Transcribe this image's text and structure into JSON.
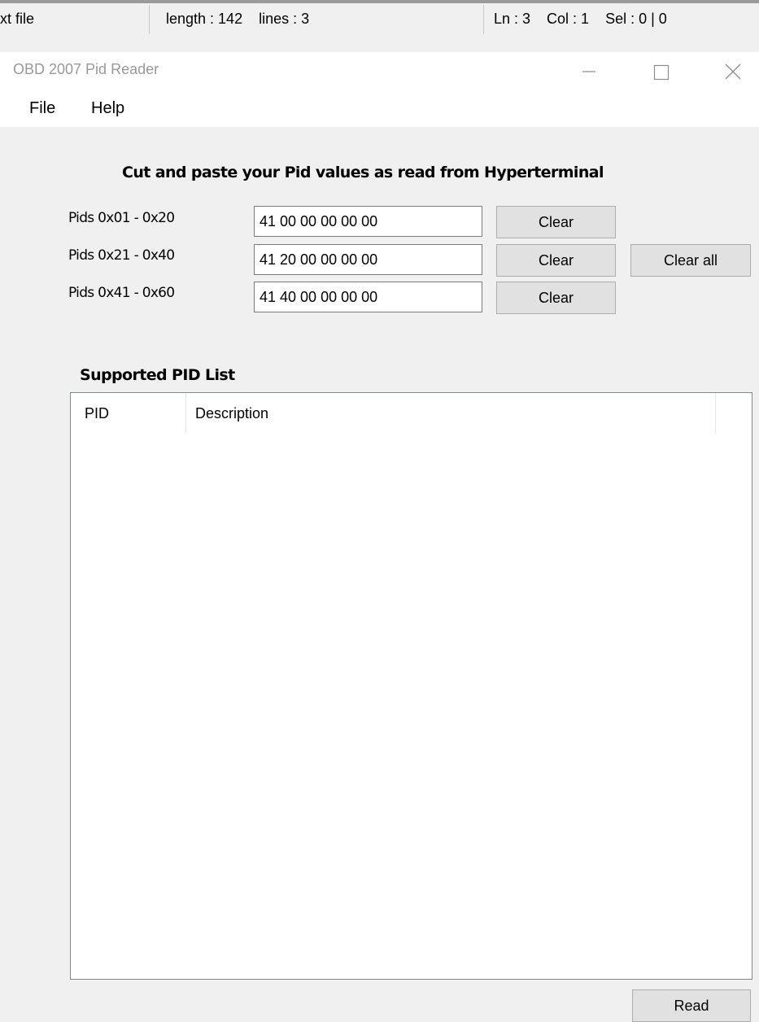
{
  "background_editor": {
    "status_bar": {
      "file_type": "xt file",
      "length_lines": "length : 142    lines : 3",
      "position": "Ln : 3    Col : 1    Sel : 0 | 0"
    }
  },
  "window": {
    "title": "OBD 2007 Pid Reader"
  },
  "menu": {
    "items": [
      "File",
      "Help"
    ]
  },
  "form": {
    "instruction": "Cut and paste your Pid values as read from Hyperterminal",
    "rows": [
      {
        "label": "Pids 0x01 - 0x20",
        "value": "41 00 00 00 00 00",
        "clear_label": "Clear"
      },
      {
        "label": "Pids 0x21 - 0x40",
        "value": "41 20 00 00 00 00",
        "clear_label": "Clear"
      },
      {
        "label": "Pids 0x41 - 0x60",
        "value": "41 40 00 00 00 00",
        "clear_label": "Clear"
      }
    ],
    "clear_all_label": "Clear all"
  },
  "pid_list": {
    "title": "Supported PID List",
    "columns": [
      "PID",
      "Description"
    ],
    "rows": []
  },
  "actions": {
    "read_label": "Read"
  },
  "colors": {
    "window_bg": "#f0f0f0",
    "button_face": "#e1e1e1",
    "button_border": "#adadad",
    "title_text": "#999999"
  }
}
